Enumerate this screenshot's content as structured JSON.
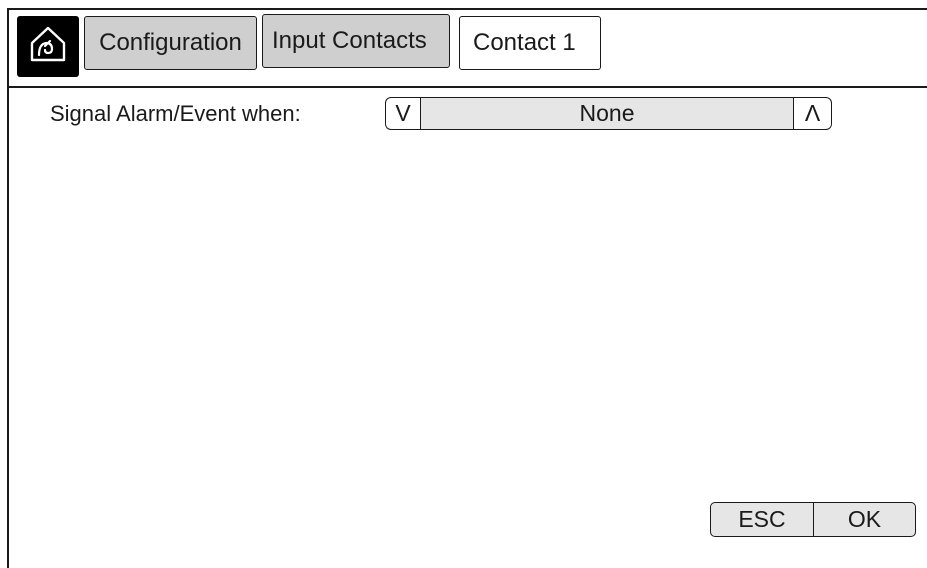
{
  "header": {
    "home_icon": "home-icon",
    "tabs": [
      {
        "label": "Configuration"
      },
      {
        "label": "Input Contacts"
      },
      {
        "label": "Contact 1"
      }
    ]
  },
  "main": {
    "signal_label": "Signal Alarm/Event when:",
    "selector": {
      "down_label": "V",
      "value": "None",
      "up_label": "Λ"
    }
  },
  "footer": {
    "esc_label": "ESC",
    "ok_label": "OK"
  },
  "colors": {
    "tab_inactive": "#cfcfcf",
    "tab_active": "#ffffff",
    "field_bg": "#e6e6e6",
    "home_bg": "#000000"
  }
}
